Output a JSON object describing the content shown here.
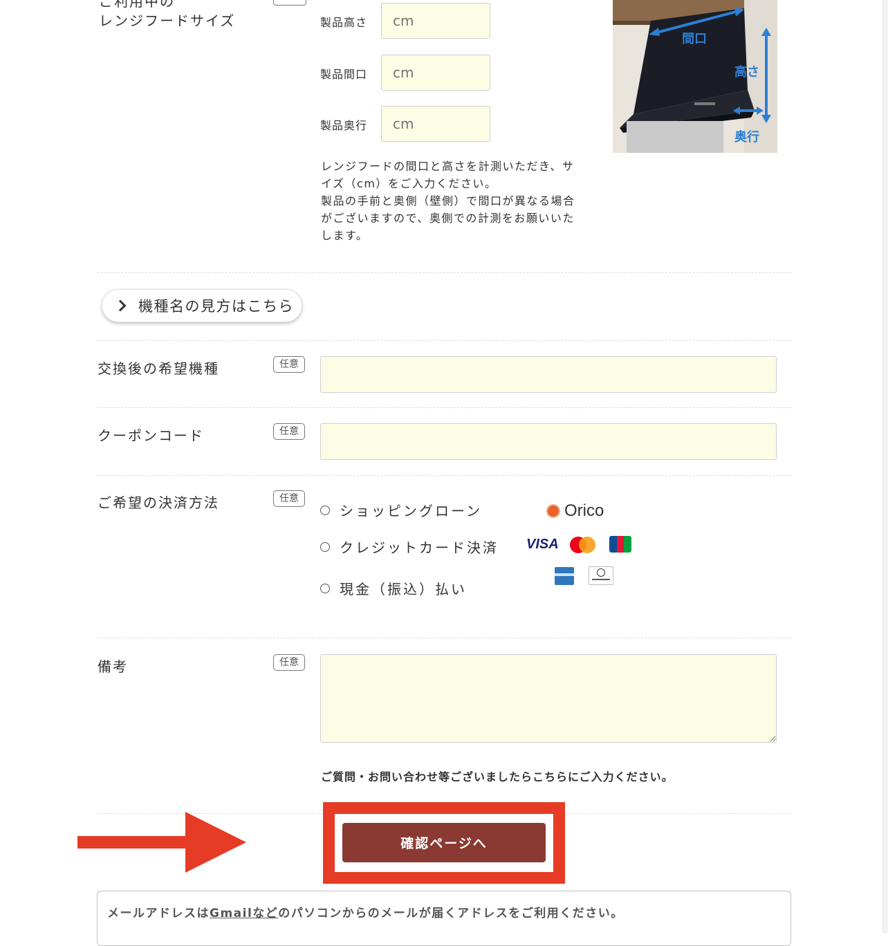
{
  "hood_section": {
    "label": "レンジフードサイズ",
    "label_cut": "ご利用中の",
    "fields": [
      {
        "label": "製品高さ",
        "placeholder": "cm"
      },
      {
        "label": "製品間口",
        "placeholder": "cm"
      },
      {
        "label": "製品奥行",
        "placeholder": "cm"
      }
    ],
    "note_lines": [
      "レンジフードの間口と高さを計測いただき、サ",
      "イズ（cm）をご入力ください。",
      "製品の手前と奥側（壁側）で間口が異なる場合",
      "がございますので、奥側での計測をお願いいた",
      "します。"
    ],
    "image_labels": {
      "width": "間口",
      "height": "高さ",
      "depth": "奥行"
    }
  },
  "model_help_button": {
    "label": "機種名の見方はこちら"
  },
  "desired_model": {
    "label": "交換後の希望機種",
    "badge": "任意"
  },
  "coupon": {
    "label": "クーポンコード",
    "badge": "任意"
  },
  "payment": {
    "label": "ご希望の決済方法",
    "badge": "任意",
    "options": [
      "ショッピングローン",
      "クレジットカード決済",
      "現金（振込）払い"
    ],
    "orico_label": "Orico",
    "cards": [
      "VISA",
      "Mastercard",
      "JCB",
      "AMERICAN EXPRESS",
      "Diners Club"
    ],
    "colors": {
      "orico": "#e9632a",
      "visa": "#1a1f71",
      "master_red": "#eb001b",
      "master_orange": "#f79e1b",
      "amex": "#2e77bc"
    }
  },
  "remarks": {
    "label": "備考",
    "badge": "任意",
    "helper": "ご質問・お問い合わせ等ございましたらこちらにご入力ください。"
  },
  "confirm_button": {
    "label": "確認ページへ",
    "color": "#8b3a33"
  },
  "annotation": {
    "color": "#e63b25"
  },
  "notice": {
    "before": "メールアドレスは",
    "link": "Gmailなど",
    "after": "のパソコンからのメールが届くアドレスをご利用ください。"
  }
}
